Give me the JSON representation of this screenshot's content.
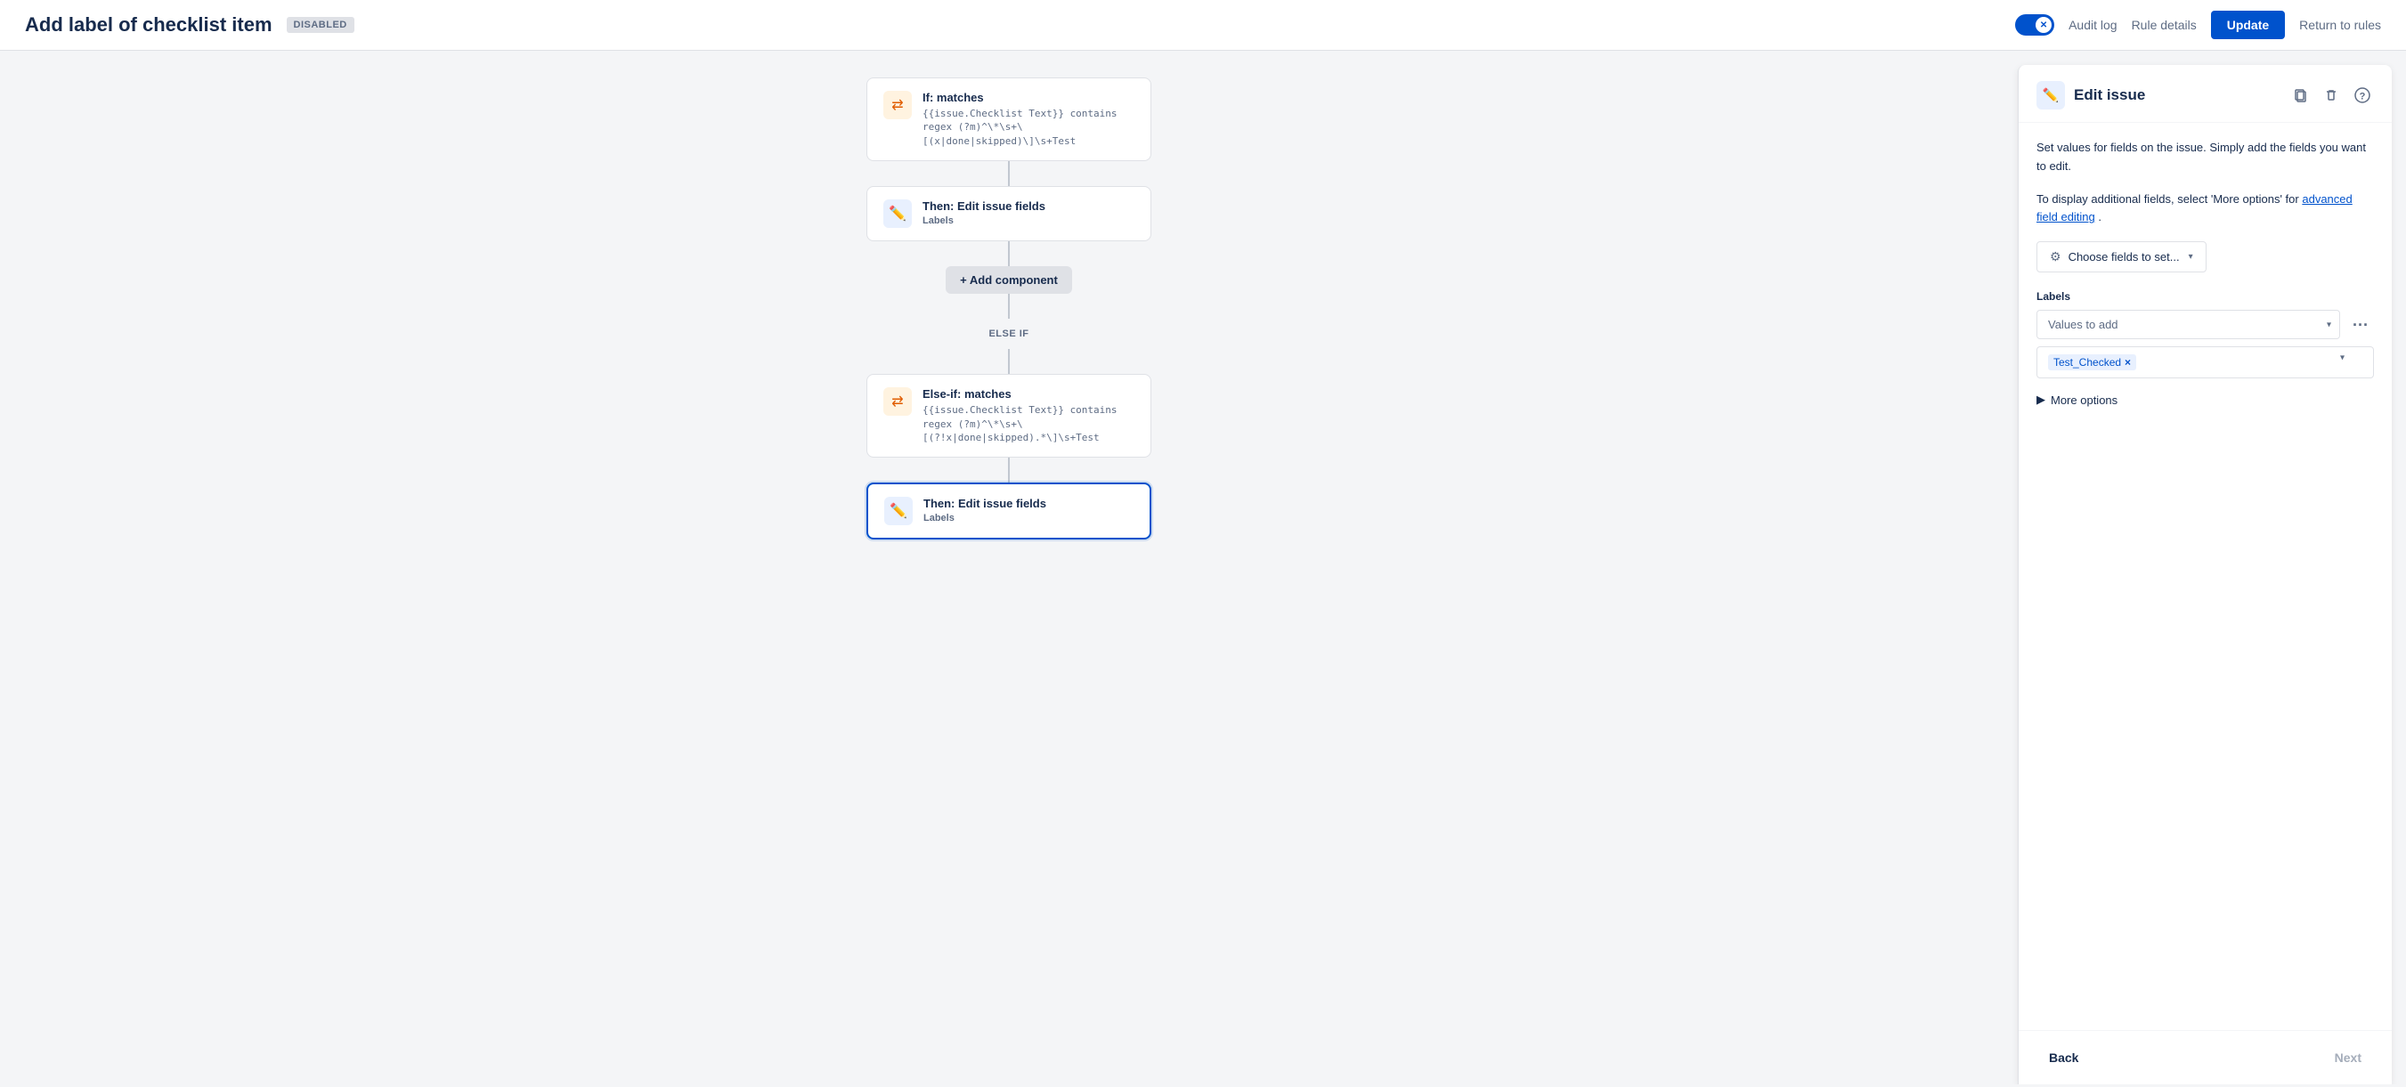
{
  "header": {
    "title": "Add label of checklist item",
    "disabled_badge": "DISABLED",
    "toggle_state": "off",
    "nav_links": [
      "Audit log",
      "Rule details"
    ],
    "update_btn": "Update",
    "return_link": "Return to rules"
  },
  "flow": {
    "nodes": [
      {
        "id": "if-matches",
        "type": "condition",
        "icon": "split-orange",
        "title": "If: matches",
        "desc": "{{issue.Checklist Text}} contains regex (?m)^\\*\\s+\\[(x|done|skipped)\\]\\s+Test"
      },
      {
        "id": "then-edit-1",
        "type": "action",
        "icon": "pencil-blue",
        "title": "Then: Edit issue fields",
        "subtitle": "Labels"
      },
      {
        "id": "add-component",
        "type": "add",
        "label": "+ Add component"
      },
      {
        "id": "else-if-label",
        "type": "label",
        "text": "ELSE IF"
      },
      {
        "id": "else-if-matches",
        "type": "condition",
        "icon": "split-orange",
        "title": "Else-if: matches",
        "desc": "{{issue.Checklist Text}} contains regex (?m)^\\*\\s+\\[(?!x|done|skipped).*\\]\\s+Test"
      },
      {
        "id": "then-edit-2",
        "type": "action",
        "icon": "pencil-blue",
        "title": "Then: Edit issue fields",
        "subtitle": "Labels",
        "selected": true
      }
    ]
  },
  "panel": {
    "title": "Edit issue",
    "icon_type": "pencil-blue",
    "desc_line1": "Set values for fields on the issue. Simply add the fields you want to edit.",
    "desc_line2": "To display additional fields, select 'More options' for",
    "advanced_link": "advanced field editing",
    "desc_suffix": ".",
    "choose_fields_btn": "Choose fields to set...",
    "labels_section": {
      "label": "Labels",
      "values_placeholder": "Values to add",
      "tag_value": "Test_Checked",
      "tag_x": "×"
    },
    "more_options_label": "More options",
    "footer": {
      "back_btn": "Back",
      "next_btn": "Next"
    }
  }
}
